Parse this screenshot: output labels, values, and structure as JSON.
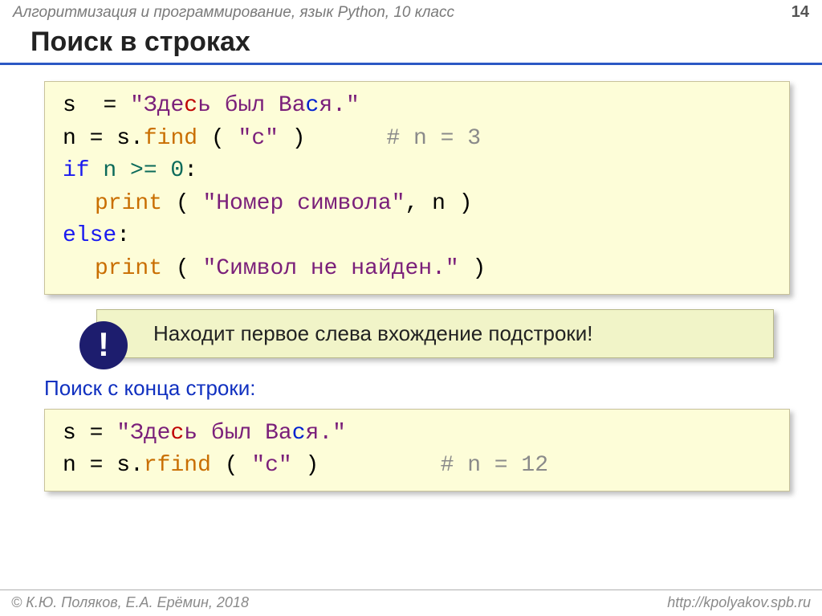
{
  "header": {
    "course": "Алгоритмизация и программирование, язык Python, 10 класс",
    "page": "14"
  },
  "title": "Поиск в строках",
  "code1": {
    "l1": {
      "v": "s",
      "eq": "=",
      "q": "\"",
      "open": "Зде",
      "c1": "с",
      "mid": "ь был Ва",
      "c2": "с",
      "end": "я.\""
    },
    "l2": {
      "lhs": "n",
      "eq": "=",
      "obj": "s.",
      "fn": "find",
      "op": "(",
      "arg": "\"с\"",
      "cp": ")",
      "cmt": "# n = 3"
    },
    "l3": {
      "kw": "if",
      "cond": "n >= 0",
      "colon": ":"
    },
    "l4": {
      "fn": "print",
      "op": "(",
      "str": "\"Номер символа\"",
      "comma": ", n",
      "cp": ")"
    },
    "l5": {
      "kw": "else",
      "colon": ":"
    },
    "l6": {
      "fn": "print",
      "op": "(",
      "str": "\"Символ не найден.\"",
      "cp": ")"
    }
  },
  "callout": {
    "badge": "!",
    "text": "Находит первое слева вхождение подстроки!"
  },
  "subhead": "Поиск с конца строки:",
  "code2": {
    "l1": {
      "v": "s",
      "eq": "=",
      "q": "\"",
      "open": "Зде",
      "c1": "с",
      "mid": "ь был Ва",
      "c2": "с",
      "end": "я.\""
    },
    "l2": {
      "lhs": "n",
      "eq": "=",
      "obj": "s.",
      "fn": "rfind",
      "op": "(",
      "arg": "\"с\"",
      "cp": ")",
      "cmt": "# n = 12"
    }
  },
  "footer": {
    "left": "© К.Ю. Поляков, Е.А. Ерёмин, 2018",
    "right": "http://kpolyakov.spb.ru"
  }
}
